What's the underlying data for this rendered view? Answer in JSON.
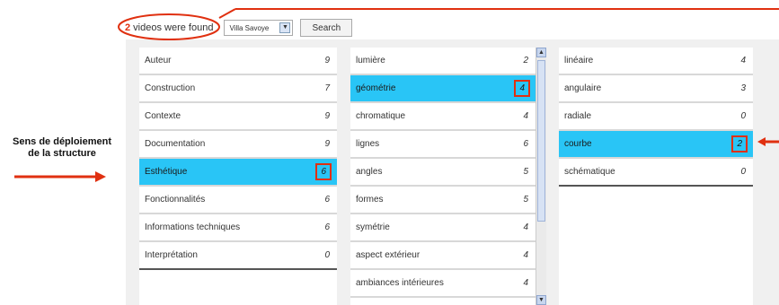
{
  "top": {
    "count": "2",
    "found_text": " videos were found",
    "select_value": "Villa Savoye",
    "search_label": "Search"
  },
  "annotation": {
    "line1": "Sens de déploiement",
    "line2": "de la structure"
  },
  "col1": [
    {
      "label": "Auteur",
      "value": "9"
    },
    {
      "label": "Construction",
      "value": "7"
    },
    {
      "label": "Contexte",
      "value": "9"
    },
    {
      "label": "Documentation",
      "value": "9"
    },
    {
      "label": "Esthétique",
      "value": "6"
    },
    {
      "label": "Fonctionnalités",
      "value": "6"
    },
    {
      "label": "Informations techniques",
      "value": "6"
    },
    {
      "label": "Interprétation",
      "value": "0"
    }
  ],
  "col2": [
    {
      "label": "lumière",
      "value": "2"
    },
    {
      "label": "géométrie",
      "value": "4"
    },
    {
      "label": "chromatique",
      "value": "4"
    },
    {
      "label": "lignes",
      "value": "6"
    },
    {
      "label": "angles",
      "value": "5"
    },
    {
      "label": "formes",
      "value": "5"
    },
    {
      "label": "symétrie",
      "value": "4"
    },
    {
      "label": "aspect extérieur",
      "value": "4"
    },
    {
      "label": "ambiances intérieures",
      "value": "4"
    }
  ],
  "col3": [
    {
      "label": "linéaire",
      "value": "4"
    },
    {
      "label": "angulaire",
      "value": "3"
    },
    {
      "label": "radiale",
      "value": "0"
    },
    {
      "label": "courbe",
      "value": "2"
    },
    {
      "label": "schématique",
      "value": "0"
    }
  ],
  "colors": {
    "selected": "#29c5f6",
    "highlight": "#e03010"
  },
  "icons": {
    "dropdown": "chevron-down-icon",
    "scroll_up": "scroll-up-icon",
    "scroll_down": "scroll-down-icon"
  }
}
